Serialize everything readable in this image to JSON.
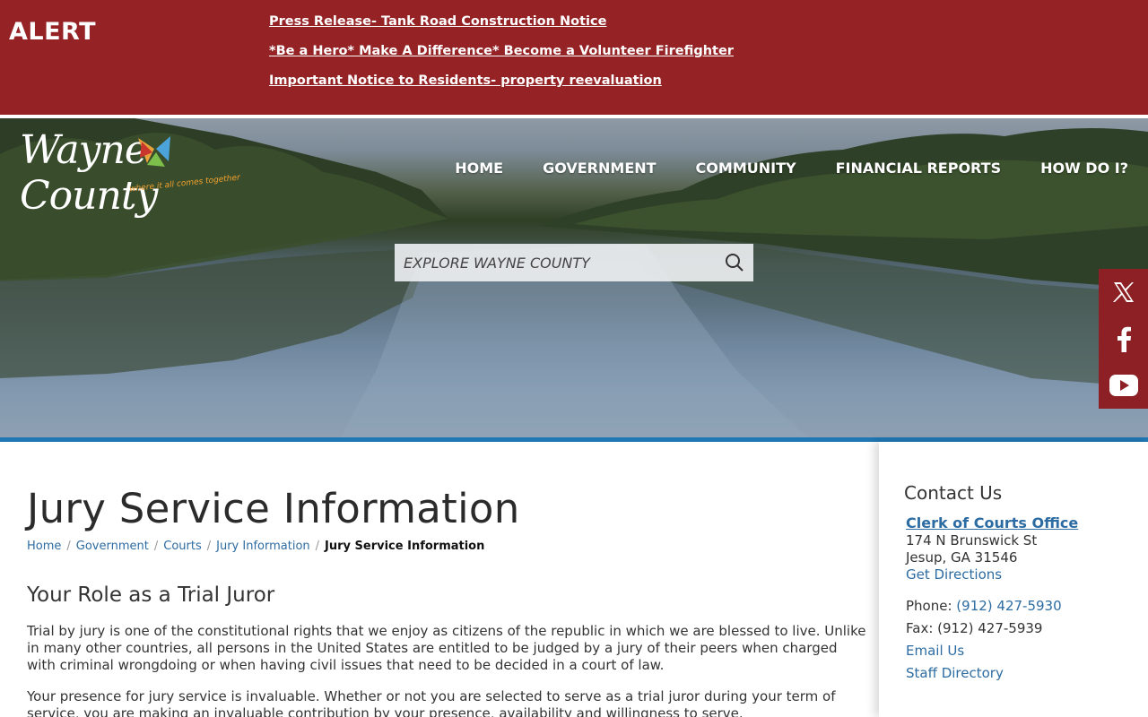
{
  "alert": {
    "label": "ALERT",
    "links": [
      "Press Release- Tank Road Construction Notice",
      "*Be a Hero* Make A Difference* Become a Volunteer Firefighter",
      "Important Notice to Residents- property reevaluation"
    ]
  },
  "header": {
    "logo": {
      "text": "Wayne County",
      "tagline": "where it all comes together"
    },
    "nav": [
      "HOME",
      "GOVERNMENT",
      "COMMUNITY",
      "FINANCIAL REPORTS",
      "HOW DO I?"
    ],
    "search": {
      "placeholder": "EXPLORE WAYNE COUNTY",
      "icon": "search-icon"
    },
    "social": [
      "x-icon",
      "facebook-icon",
      "youtube-icon"
    ]
  },
  "main": {
    "title": "Jury Service Information",
    "breadcrumb": [
      "Home",
      "Government",
      "Courts",
      "Jury Information"
    ],
    "breadcrumb_current": "Jury Service Information",
    "section_heading": "Your Role as a Trial Juror",
    "paragraphs": [
      "Trial by jury is one of the constitutional rights that we enjoy as citizens of the republic in which we are blessed to live. Unlike in many other countries, all persons in the United States are entitled to be judged by a jury of their peers when charged with criminal wrongdoing or when having civil issues that need to be decided in a court of law.",
      "Your presence for jury service is invaluable. Whether or not you are selected to serve as a trial juror during your term of service, you are making an invaluable contribution by your presence, availability and willingness to serve."
    ]
  },
  "sidebar": {
    "heading": "Contact Us",
    "office": "Clerk of Courts Office",
    "address_1": "174 N Brunswick St",
    "address_2": "Jesup, GA 31546",
    "directions": "Get Directions",
    "phone_label": "Phone: ",
    "phone": "(912) 427-5930",
    "fax": "Fax: (912) 427-5939",
    "email": "Email Us",
    "staff": "Staff Directory"
  },
  "colors": {
    "alert_bg": "#952326",
    "accent_blue": "#1f77b4",
    "link": "#2d6ca2",
    "social_bg": "#8c2024"
  }
}
